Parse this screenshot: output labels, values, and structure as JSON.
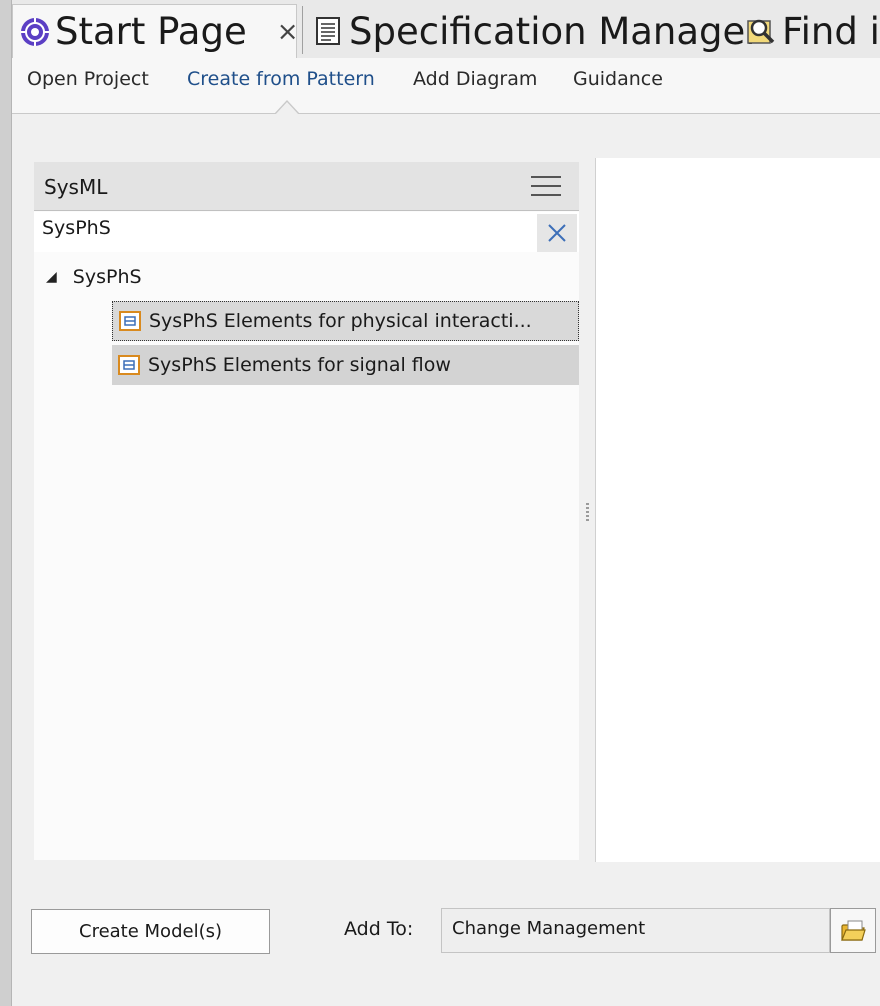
{
  "tabs": [
    {
      "label": "Start Page",
      "close": "×",
      "icon": "start-page-icon"
    },
    {
      "label": "Specification Manager",
      "icon": "document-icon"
    },
    {
      "label": "Find in",
      "icon": "find-icon"
    }
  ],
  "subnav": {
    "items": [
      "Open Project",
      "Create from Pattern",
      "Add Diagram",
      "Guidance"
    ],
    "active": "Create from Pattern"
  },
  "panel": {
    "title": "SysML",
    "filter_value": "SysPhS",
    "tree": {
      "root": {
        "label": "SysPhS",
        "expander": "◢"
      },
      "items": [
        {
          "label": "SysPhS Elements for physical interacti...",
          "state": "focused"
        },
        {
          "label": "SysPhS Elements for signal flow",
          "state": "selected"
        }
      ]
    }
  },
  "footer": {
    "create_label": "Create Model(s)",
    "add_to_label": "Add To:",
    "add_to_value": "Change Management"
  },
  "colors": {
    "accent": "#1f4f8a",
    "start_icon": "#5b3fc4",
    "package_orange": "#d98a1f",
    "package_blue": "#3d6fb8",
    "folder": "#e9b530"
  }
}
